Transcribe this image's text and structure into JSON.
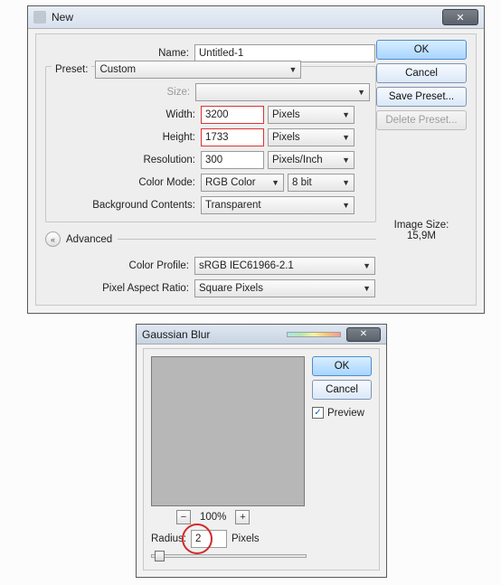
{
  "new_dialog": {
    "title": "New",
    "labels": {
      "name": "Name:",
      "preset": "Preset:",
      "size": "Size:",
      "width": "Width:",
      "height": "Height:",
      "resolution": "Resolution:",
      "color_mode": "Color Mode:",
      "bg_contents": "Background Contents:",
      "advanced": "Advanced",
      "color_profile": "Color Profile:",
      "pixel_aspect": "Pixel Aspect Ratio:",
      "image_size_lbl": "Image Size:"
    },
    "values": {
      "name": "Untitled-1",
      "preset": "Custom",
      "size": "",
      "width": "3200",
      "height": "1733",
      "resolution": "300",
      "color_mode": "RGB Color",
      "bit_depth": "8 bit",
      "bg_contents": "Transparent",
      "color_profile": "sRGB IEC61966-2.1",
      "pixel_aspect": "Square Pixels",
      "image_size": "15,9M"
    },
    "units": {
      "width": "Pixels",
      "height": "Pixels",
      "resolution": "Pixels/Inch"
    },
    "buttons": {
      "ok": "OK",
      "cancel": "Cancel",
      "save_preset": "Save Preset...",
      "delete_preset": "Delete Preset..."
    }
  },
  "gaussian_dialog": {
    "title": "Gaussian Blur",
    "buttons": {
      "ok": "OK",
      "cancel": "Cancel"
    },
    "preview_label": "Preview",
    "preview_checked": true,
    "zoom": "100%",
    "radius_label": "Radius:",
    "radius_value": "2",
    "radius_unit": "Pixels"
  }
}
